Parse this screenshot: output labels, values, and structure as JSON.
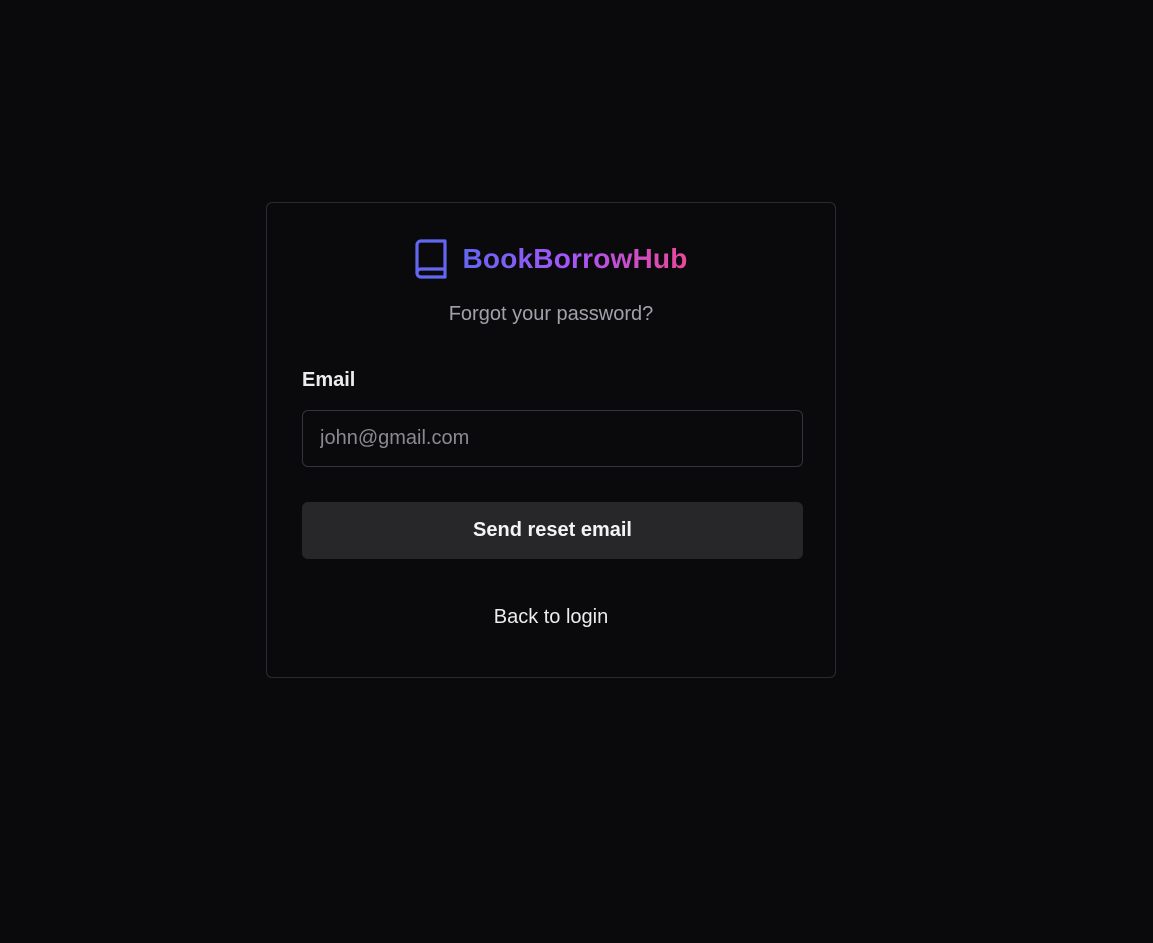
{
  "brand": {
    "name": "BookBorrowHub",
    "icon": "book-icon",
    "gradient_colors": [
      "#6366f1",
      "#a855f7",
      "#ec4899"
    ]
  },
  "form": {
    "subtitle": "Forgot your password?",
    "email_label": "Email",
    "email_value": "",
    "email_placeholder": "john@gmail.com",
    "submit_label": "Send reset email",
    "back_link_label": "Back to login"
  },
  "colors": {
    "background": "#0a0a0c",
    "card_border": "#2b2b30",
    "button_background": "#27272a",
    "muted_text": "#a1a1aa"
  }
}
